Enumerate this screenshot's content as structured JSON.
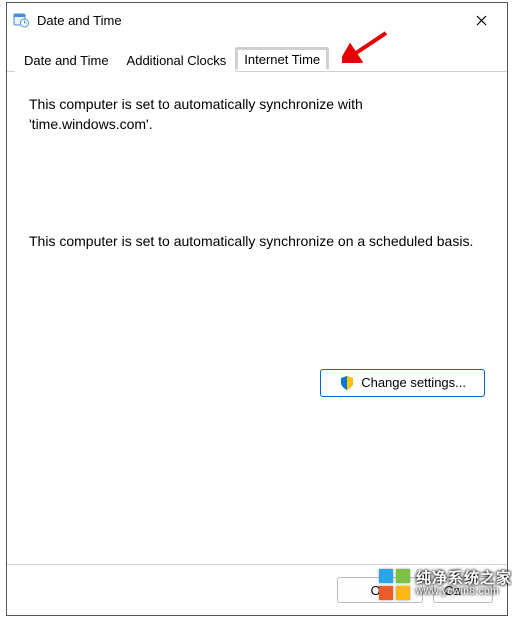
{
  "window": {
    "title": "Date and Time"
  },
  "tabs": [
    {
      "label": "Date and Time"
    },
    {
      "label": "Additional Clocks"
    },
    {
      "label": "Internet Time"
    }
  ],
  "content": {
    "sync_server_text": "This computer is set to automatically synchronize with 'time.windows.com'.",
    "sync_schedule_text": "This computer is set to automatically synchronize on a scheduled basis."
  },
  "buttons": {
    "change_settings": "Change settings...",
    "ok": "OK",
    "cancel": "Ca"
  },
  "watermark": {
    "line1": "纯净系统之家",
    "line2": "www.ycwin8.com"
  }
}
